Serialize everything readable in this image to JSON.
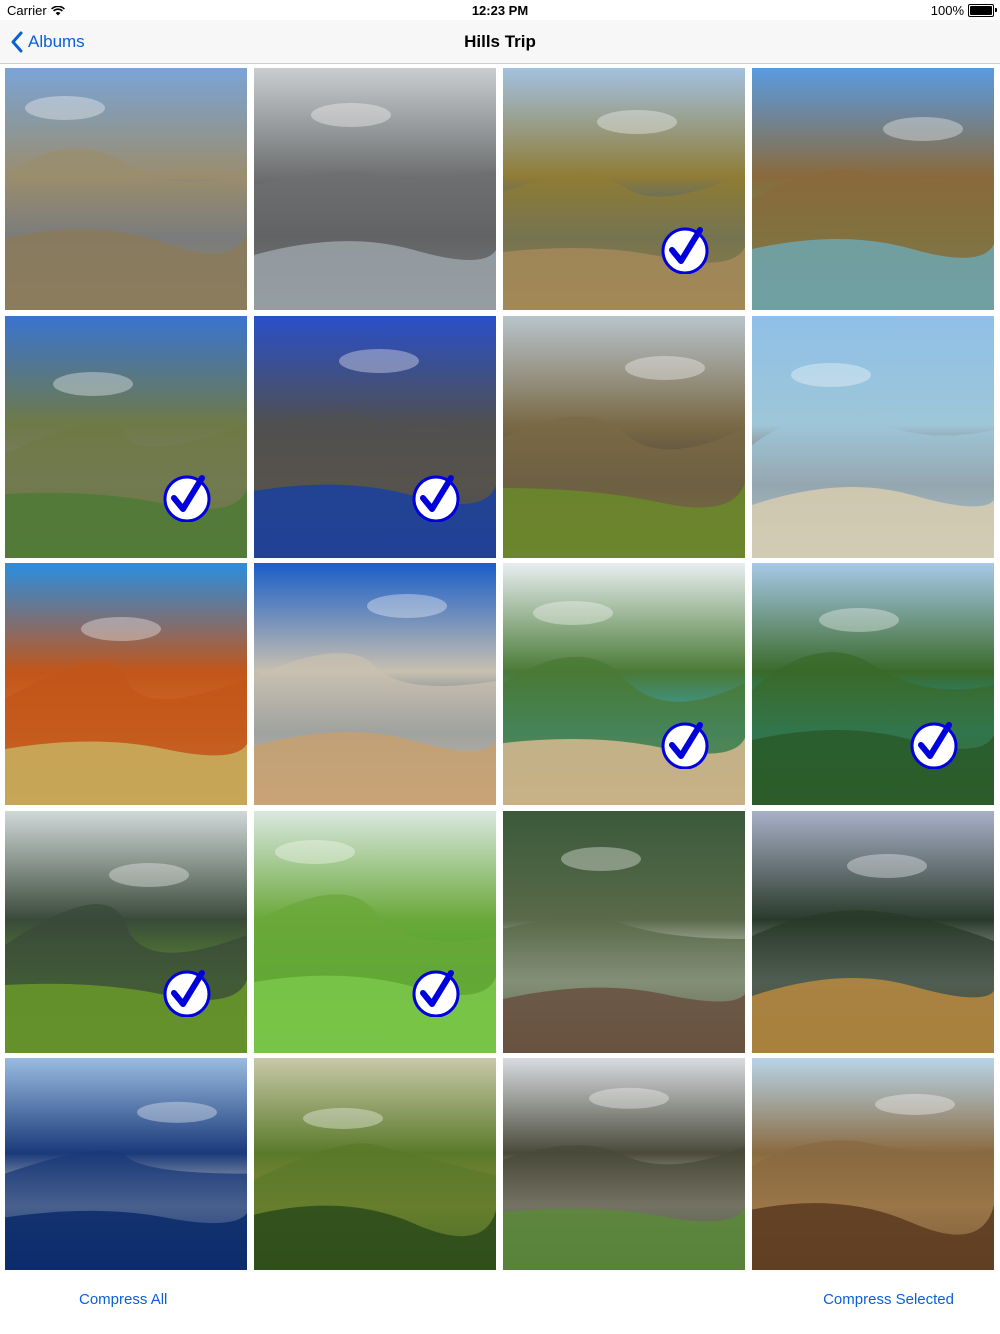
{
  "status_bar": {
    "carrier": "Carrier",
    "time": "12:23 PM",
    "battery": "100%",
    "battery_level": 1.0,
    "wifi_icon": "wifi-icon",
    "battery_icon": "battery-icon"
  },
  "nav": {
    "back_label": "Albums",
    "back_icon": "chevron-left-icon",
    "title": "Hills Trip"
  },
  "colors": {
    "accent": "#0a60d8",
    "check_color": "#0000dd"
  },
  "photos": [
    {
      "name": "photo-tundra-lake",
      "selected": false,
      "sky": "#7aa4d6",
      "top": "#9a8d6e",
      "mid": "#1e47a8",
      "ground": "#8a7a5a"
    },
    {
      "name": "photo-sea-cliff",
      "selected": false,
      "sky": "#c9cdd0",
      "top": "#6d6f70",
      "mid": "#3e4042",
      "ground": "#9aa3a8"
    },
    {
      "name": "photo-coastal-beach",
      "selected": true,
      "sky": "#a3c1e0",
      "top": "#8f7c36",
      "mid": "#2a5aa0",
      "ground": "#a58a5a"
    },
    {
      "name": "photo-rock-island",
      "selected": false,
      "sky": "#5a9be0",
      "top": "#8a6a3c",
      "mid": "#6c8a4a",
      "ground": "#6fa7b0"
    },
    {
      "name": "photo-stone-cottages",
      "selected": true,
      "sky": "#3a74d0",
      "top": "#6f7a46",
      "mid": "#7c7c70",
      "ground": "#4f7a36"
    },
    {
      "name": "photo-rock-spire",
      "selected": true,
      "sky": "#2a4fc8",
      "top": "#505050",
      "mid": "#6a5a40",
      "ground": "#1a3fa0"
    },
    {
      "name": "photo-moai",
      "selected": false,
      "sky": "#b8c4cc",
      "top": "#7a6a46",
      "mid": "#4a4238",
      "ground": "#6a8a2a"
    },
    {
      "name": "photo-longtail-boats",
      "selected": false,
      "sky": "#8fc0e8",
      "top": "#9ec6d8",
      "mid": "#7a4a34",
      "ground": "#d8ccb0"
    },
    {
      "name": "photo-red-dune",
      "selected": false,
      "sky": "#2a8ee0",
      "top": "#c2561a",
      "mid": "#d06a2a",
      "ground": "#c8b060"
    },
    {
      "name": "photo-white-cliffs",
      "selected": false,
      "sky": "#1a5ec8",
      "top": "#c8c0b0",
      "mid": "#2a4a70",
      "ground": "#c8a070"
    },
    {
      "name": "photo-tropical-beach",
      "selected": true,
      "sky": "#e8eef0",
      "top": "#4a7a36",
      "mid": "#3aa4c0",
      "ground": "#d8b890"
    },
    {
      "name": "photo-turquoise-bay",
      "selected": true,
      "sky": "#a8c8e8",
      "top": "#3a6a2a",
      "mid": "#1e9ab8",
      "ground": "#2a5a2a"
    },
    {
      "name": "photo-machu-picchu",
      "selected": true,
      "sky": "#d0d8d8",
      "top": "#3a4a3a",
      "mid": "#5a8a30",
      "ground": "#6a9a2a"
    },
    {
      "name": "photo-rice-terraces",
      "selected": true,
      "sky": "#dae8e0",
      "top": "#6aa83a",
      "mid": "#4aa82a",
      "ground": "#7ac84a"
    },
    {
      "name": "photo-crashing-wave",
      "selected": false,
      "sky": "#3a5a3a",
      "top": "#5a6a4a",
      "mid": "#ffffff",
      "ground": "#6a5040"
    },
    {
      "name": "photo-headland-beach",
      "selected": false,
      "sky": "#a8b0c8",
      "top": "#2a3a2a",
      "mid": "#c0c8c8",
      "ground": "#b88a40"
    },
    {
      "name": "photo-rock-arches",
      "selected": false,
      "sky": "#9abce0",
      "top": "#1a3a7a",
      "mid": "#d8d4c8",
      "ground": "#0a2a6a"
    },
    {
      "name": "photo-chocolate-hills",
      "selected": false,
      "sky": "#c8c8a8",
      "top": "#5a7a2a",
      "mid": "#8a8a3a",
      "ground": "#2a4a1a"
    },
    {
      "name": "photo-alpacas",
      "selected": false,
      "sky": "#d8dce0",
      "top": "#4a4a3a",
      "mid": "#f0ece0",
      "ground": "#5a8a3a"
    },
    {
      "name": "photo-sea-cave",
      "selected": false,
      "sky": "#b8d4e8",
      "top": "#8a6a40",
      "mid": "#c89860",
      "ground": "#5a3a20"
    }
  ],
  "toolbar": {
    "compress_all": "Compress All",
    "compress_selected": "Compress Selected"
  }
}
